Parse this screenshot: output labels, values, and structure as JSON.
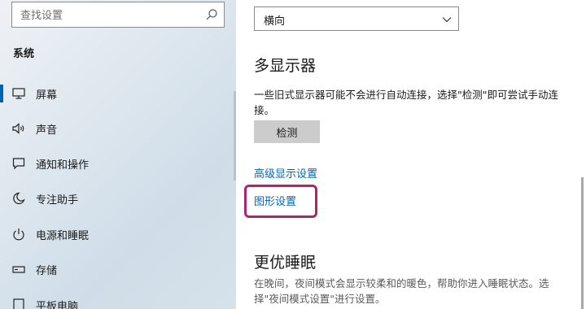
{
  "sidebar": {
    "search": {
      "placeholder": "查找设置"
    },
    "section": "系统",
    "items": [
      {
        "label": "屏幕",
        "icon": "monitor-icon",
        "active": true
      },
      {
        "label": "声音",
        "icon": "speaker-icon"
      },
      {
        "label": "通知和操作",
        "icon": "notification-icon"
      },
      {
        "label": "专注助手",
        "icon": "moon-icon"
      },
      {
        "label": "电源和睡眠",
        "icon": "power-icon"
      },
      {
        "label": "存储",
        "icon": "storage-icon"
      },
      {
        "label": "平板电脑",
        "icon": "tablet-icon"
      }
    ],
    "accent": "#0063b1"
  },
  "main": {
    "orientation": {
      "value": "横向"
    },
    "multi_display": {
      "heading": "多显示器",
      "description": "一些旧式显示器可能不会进行自动连接，选择\"检测\"即可尝试手动连接。",
      "detect_button": "检测"
    },
    "links": {
      "advanced_display": "高级显示设置",
      "graphics": "图形设置"
    },
    "night": {
      "heading": "更优睡眠",
      "description": "在晚间，夜间模式会显示较柔和的暖色，帮助你进入睡眠状态。选择\"夜间模式设置\"进行设置。"
    },
    "link_color": "#0066b4",
    "highlight_color": "#b0246e"
  }
}
